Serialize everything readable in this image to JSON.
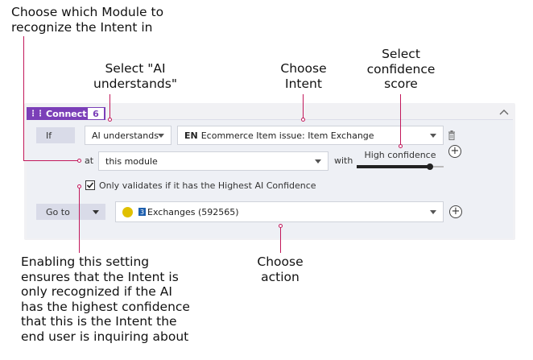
{
  "annotations": {
    "module": "Choose which Module to\nrecognize the Intent in",
    "ai": "Select \"AI\nunderstands\"",
    "intent": "Choose\nIntent",
    "confidence": "Select\nconfidence\nscore",
    "setting": "Enabling this setting\nensures that the Intent is\nonly recognized if the AI\nhas the highest confidence\nthat this is the Intent the\nend user is inquiring about",
    "action": "Choose\naction"
  },
  "connection": {
    "label": "Connection",
    "count": "6"
  },
  "condition": {
    "if_label": "If",
    "ai_select": "AI understands",
    "intent_lang": "EN",
    "intent_value": "Ecommerce Item issue: Item Exchange",
    "at_label": "at",
    "module_select": "this module",
    "with_label": "with",
    "confidence_label": "High confidence",
    "confidence_level": 0.84,
    "checkbox_checked": true,
    "checkbox_label": "Only validates if it has the Highest AI Confidence"
  },
  "action": {
    "goto_label": "Go to",
    "target_badge": "3",
    "target_value": "Exchanges (592565)"
  },
  "colors": {
    "accent": "#7b3fb8",
    "annotation_line": "#c2185b",
    "target_dot": "#e0c000",
    "badge": "#1e5fae"
  },
  "icons": [
    "drag-grip-icon",
    "chevron-up-icon",
    "trash-icon",
    "plus-icon",
    "checkbox-icon",
    "caret-down-icon"
  ]
}
